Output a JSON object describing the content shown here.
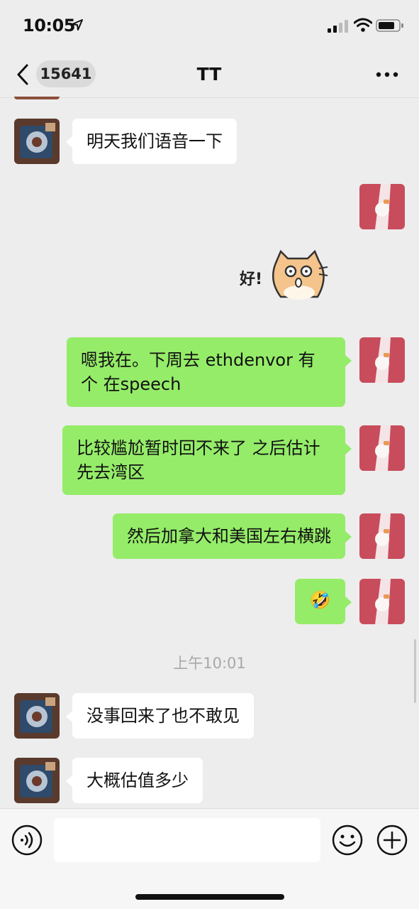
{
  "status_bar": {
    "time": "10:05"
  },
  "nav": {
    "unread_count": "15641",
    "title": "TT"
  },
  "messages": {
    "m1": "明天我们语音一下",
    "m2": "嗯我在。下周去 ethdenvor 有个 在speech",
    "m3": "比较尴尬暂时回不来了 之后估计先去湾区",
    "m4": "然后加拿大和美国左右横跳",
    "m5": "🤣",
    "timestamp": "上午10:01",
    "m6": "没事回来了也不敢见",
    "m7": "大概估值多少"
  },
  "sticker": {
    "text": "好!"
  },
  "icons": {
    "back": "chevron-left-icon",
    "more": "more-dots-icon",
    "voice": "voice-icon",
    "emoji": "emoji-icon",
    "add": "plus-circle-icon"
  },
  "colors": {
    "outgoing_bubble": "#95ec69",
    "incoming_bubble": "#ffffff",
    "background": "#ededed"
  }
}
